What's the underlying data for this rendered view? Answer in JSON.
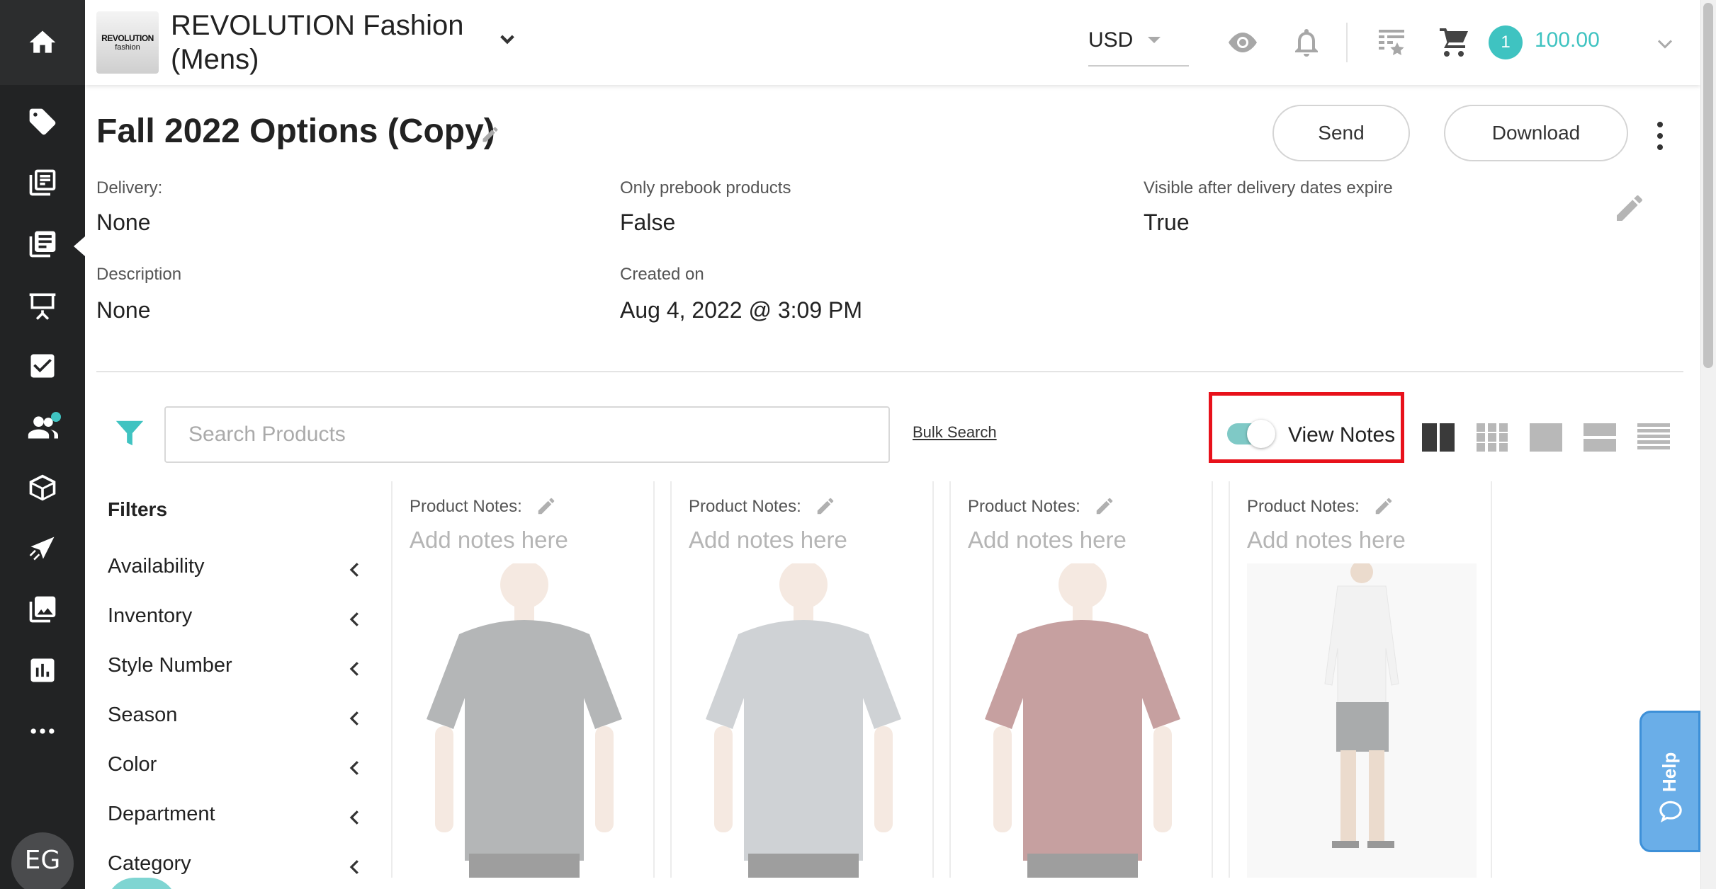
{
  "header": {
    "logo_line1": "REVOLUTION",
    "logo_line2": "fashion",
    "brand_name": "REVOLUTION Fashion (Mens)",
    "currency": "USD",
    "cart_count": "1",
    "cart_total": "100.00"
  },
  "rail": {
    "items": [
      "home-icon",
      "price-tag-icon",
      "catalog-icon",
      "linesheet-icon",
      "presentation-icon",
      "checklist-icon",
      "customers-icon",
      "box-icon",
      "email-campaign-icon",
      "images-icon",
      "reports-icon",
      "more-icon"
    ],
    "avatar_initials": "EG"
  },
  "page": {
    "title": "Fall 2022 Options (Copy)",
    "send_label": "Send",
    "download_label": "Download"
  },
  "meta": {
    "delivery_label": "Delivery:",
    "delivery_value": "None",
    "prebook_label": "Only prebook products",
    "prebook_value": "False",
    "visible_label": "Visible after delivery dates expire",
    "visible_value": "True",
    "description_label": "Description",
    "description_value": "None",
    "created_label": "Created on",
    "created_value": "Aug 4, 2022 @ 3:09 PM"
  },
  "toolbar": {
    "search_placeholder": "Search Products",
    "bulk_search_label": "Bulk Search",
    "view_notes_label": "View Notes",
    "view_notes_on": true
  },
  "filters": {
    "title": "Filters",
    "items": [
      "Availability",
      "Inventory",
      "Style Number",
      "Season",
      "Color",
      "Department",
      "Category"
    ]
  },
  "products": [
    {
      "notes_label": "Product Notes:",
      "notes_placeholder": "Add notes here",
      "image": "grey-tshirt",
      "shirt_color": "#4e5255"
    },
    {
      "notes_label": "Product Notes:",
      "notes_placeholder": "Add notes here",
      "image": "light-grey-tshirt",
      "shirt_color": "#8f969c"
    },
    {
      "notes_label": "Product Notes:",
      "notes_placeholder": "Add notes here",
      "image": "burgundy-tshirt",
      "shirt_color": "#7a1f1f"
    },
    {
      "notes_label": "Product Notes:",
      "notes_placeholder": "Add notes here",
      "image": "white-hoodie-shorts",
      "shirt_color": "#f2f2f2"
    }
  ],
  "help": {
    "label": "Help"
  },
  "colors": {
    "accent": "#3fc3c1",
    "highlight": "#e8111b",
    "rail": "#222324",
    "help": "#6aaee8"
  }
}
